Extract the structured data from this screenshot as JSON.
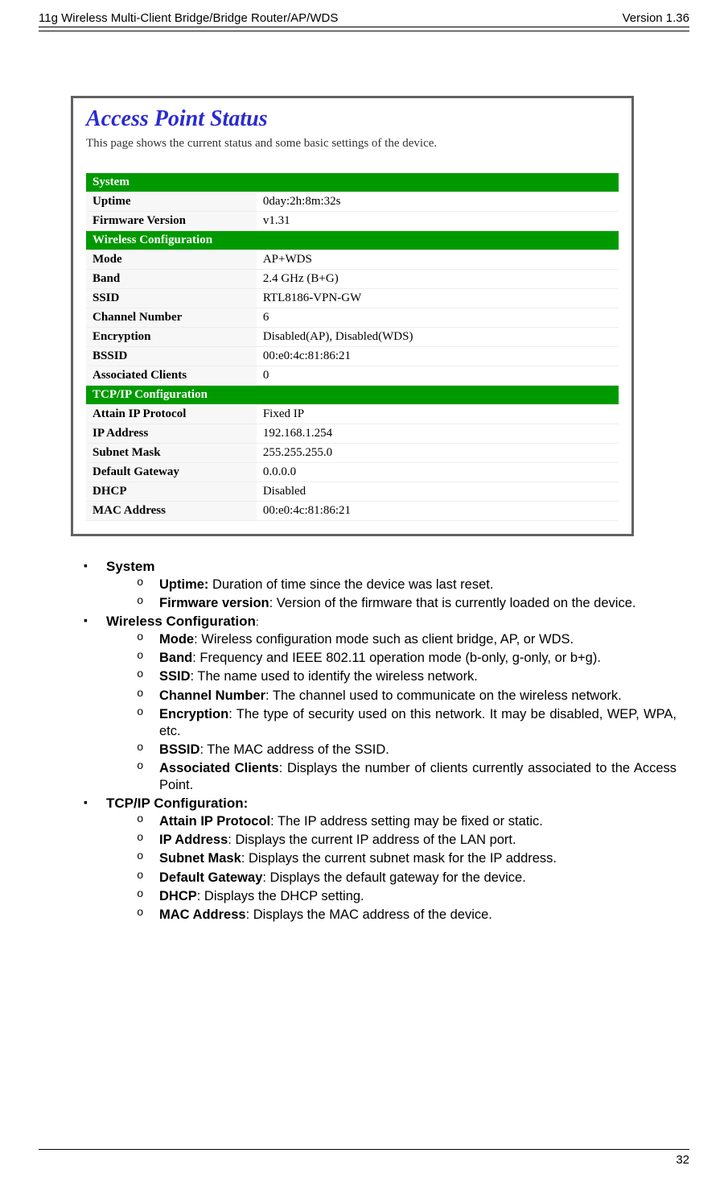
{
  "header": {
    "left": "11g Wireless Multi-Client Bridge/Bridge Router/AP/WDS",
    "right": "Version 1.36"
  },
  "panel": {
    "title": "Access Point Status",
    "subtitle": "This page shows the current status and some basic settings of the device.",
    "sections": [
      {
        "name": "System",
        "rows": [
          {
            "label": "Uptime",
            "value": "0day:2h:8m:32s"
          },
          {
            "label": "Firmware Version",
            "value": "v1.31"
          }
        ]
      },
      {
        "name": "Wireless Configuration",
        "rows": [
          {
            "label": "Mode",
            "value": "AP+WDS"
          },
          {
            "label": "Band",
            "value": "2.4 GHz (B+G)"
          },
          {
            "label": "SSID",
            "value": "RTL8186-VPN-GW"
          },
          {
            "label": "Channel Number",
            "value": "6"
          },
          {
            "label": "Encryption",
            "value": "Disabled(AP), Disabled(WDS)"
          },
          {
            "label": "BSSID",
            "value": "00:e0:4c:81:86:21"
          },
          {
            "label": "Associated Clients",
            "value": "0"
          }
        ]
      },
      {
        "name": "TCP/IP Configuration",
        "rows": [
          {
            "label": "Attain IP Protocol",
            "value": "Fixed IP"
          },
          {
            "label": "IP Address",
            "value": "192.168.1.254"
          },
          {
            "label": "Subnet Mask",
            "value": "255.255.255.0"
          },
          {
            "label": "Default Gateway",
            "value": "0.0.0.0"
          },
          {
            "label": "DHCP",
            "value": "Disabled"
          },
          {
            "label": "MAC Address",
            "value": "00:e0:4c:81:86:21"
          }
        ]
      }
    ]
  },
  "bullets": [
    {
      "title": "System",
      "items": [
        {
          "b": "Uptime:",
          "t": " Duration of time since the device was last reset."
        },
        {
          "b": "Firmware version",
          "t": ": Version of the firmware that is currently loaded on the device."
        }
      ]
    },
    {
      "title": "Wireless Configuration",
      "suffix": ":",
      "items": [
        {
          "b": "Mode",
          "t": ": Wireless configuration mode such as client bridge, AP, or WDS."
        },
        {
          "b": "Band",
          "t": ": Frequency and IEEE 802.11 operation mode (b-only, g-only, or b+g)."
        },
        {
          "b": "SSID",
          "t": ": The name used to identify the wireless network."
        },
        {
          "b": "Channel Number",
          "t": ": The channel used to communicate on the wireless network."
        },
        {
          "b": "Encryption",
          "t": ": The type of security used on this network. It may be disabled, WEP, WPA, etc."
        },
        {
          "b": "BSSID",
          "t": ": The MAC address of the SSID."
        },
        {
          "b": "Associated Clients",
          "t": ": Displays the number of clients currently associated to the Access Point."
        }
      ]
    },
    {
      "title": "TCP/IP Configuration:",
      "items": [
        {
          "b": "Attain IP Protocol",
          "t": ": The IP address setting may be fixed or static."
        },
        {
          "b": "IP Address",
          "t": ": Displays the current IP address of the LAN port."
        },
        {
          "b": "Subnet Mask",
          "t": ": Displays the current subnet mask for the IP address."
        },
        {
          "b": "Default Gateway",
          "t": ": Displays the default gateway for the device."
        },
        {
          "b": "DHCP",
          "t": ": Displays the DHCP setting."
        },
        {
          "b": "MAC Address",
          "t": ": Displays the MAC address of the device."
        }
      ]
    }
  ],
  "footer": {
    "page": "32"
  }
}
